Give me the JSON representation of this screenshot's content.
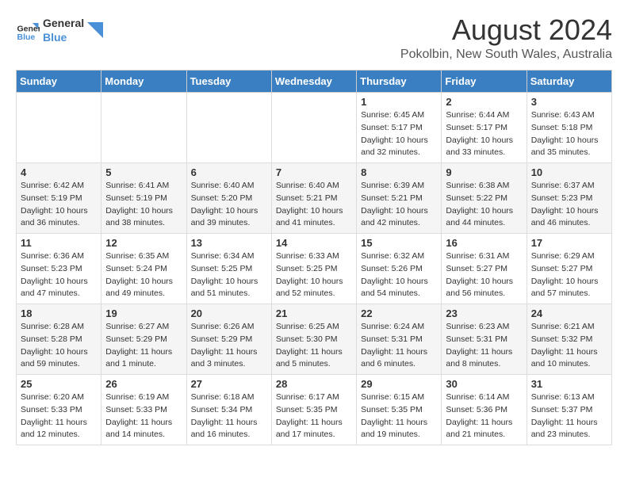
{
  "header": {
    "logo_line1": "General",
    "logo_line2": "Blue",
    "title": "August 2024",
    "subtitle": "Pokolbin, New South Wales, Australia"
  },
  "days_of_week": [
    "Sunday",
    "Monday",
    "Tuesday",
    "Wednesday",
    "Thursday",
    "Friday",
    "Saturday"
  ],
  "weeks": [
    [
      {
        "day": "",
        "info": ""
      },
      {
        "day": "",
        "info": ""
      },
      {
        "day": "",
        "info": ""
      },
      {
        "day": "",
        "info": ""
      },
      {
        "day": "1",
        "info": "Sunrise: 6:45 AM\nSunset: 5:17 PM\nDaylight: 10 hours\nand 32 minutes."
      },
      {
        "day": "2",
        "info": "Sunrise: 6:44 AM\nSunset: 5:17 PM\nDaylight: 10 hours\nand 33 minutes."
      },
      {
        "day": "3",
        "info": "Sunrise: 6:43 AM\nSunset: 5:18 PM\nDaylight: 10 hours\nand 35 minutes."
      }
    ],
    [
      {
        "day": "4",
        "info": "Sunrise: 6:42 AM\nSunset: 5:19 PM\nDaylight: 10 hours\nand 36 minutes."
      },
      {
        "day": "5",
        "info": "Sunrise: 6:41 AM\nSunset: 5:19 PM\nDaylight: 10 hours\nand 38 minutes."
      },
      {
        "day": "6",
        "info": "Sunrise: 6:40 AM\nSunset: 5:20 PM\nDaylight: 10 hours\nand 39 minutes."
      },
      {
        "day": "7",
        "info": "Sunrise: 6:40 AM\nSunset: 5:21 PM\nDaylight: 10 hours\nand 41 minutes."
      },
      {
        "day": "8",
        "info": "Sunrise: 6:39 AM\nSunset: 5:21 PM\nDaylight: 10 hours\nand 42 minutes."
      },
      {
        "day": "9",
        "info": "Sunrise: 6:38 AM\nSunset: 5:22 PM\nDaylight: 10 hours\nand 44 minutes."
      },
      {
        "day": "10",
        "info": "Sunrise: 6:37 AM\nSunset: 5:23 PM\nDaylight: 10 hours\nand 46 minutes."
      }
    ],
    [
      {
        "day": "11",
        "info": "Sunrise: 6:36 AM\nSunset: 5:23 PM\nDaylight: 10 hours\nand 47 minutes."
      },
      {
        "day": "12",
        "info": "Sunrise: 6:35 AM\nSunset: 5:24 PM\nDaylight: 10 hours\nand 49 minutes."
      },
      {
        "day": "13",
        "info": "Sunrise: 6:34 AM\nSunset: 5:25 PM\nDaylight: 10 hours\nand 51 minutes."
      },
      {
        "day": "14",
        "info": "Sunrise: 6:33 AM\nSunset: 5:25 PM\nDaylight: 10 hours\nand 52 minutes."
      },
      {
        "day": "15",
        "info": "Sunrise: 6:32 AM\nSunset: 5:26 PM\nDaylight: 10 hours\nand 54 minutes."
      },
      {
        "day": "16",
        "info": "Sunrise: 6:31 AM\nSunset: 5:27 PM\nDaylight: 10 hours\nand 56 minutes."
      },
      {
        "day": "17",
        "info": "Sunrise: 6:29 AM\nSunset: 5:27 PM\nDaylight: 10 hours\nand 57 minutes."
      }
    ],
    [
      {
        "day": "18",
        "info": "Sunrise: 6:28 AM\nSunset: 5:28 PM\nDaylight: 10 hours\nand 59 minutes."
      },
      {
        "day": "19",
        "info": "Sunrise: 6:27 AM\nSunset: 5:29 PM\nDaylight: 11 hours\nand 1 minute."
      },
      {
        "day": "20",
        "info": "Sunrise: 6:26 AM\nSunset: 5:29 PM\nDaylight: 11 hours\nand 3 minutes."
      },
      {
        "day": "21",
        "info": "Sunrise: 6:25 AM\nSunset: 5:30 PM\nDaylight: 11 hours\nand 5 minutes."
      },
      {
        "day": "22",
        "info": "Sunrise: 6:24 AM\nSunset: 5:31 PM\nDaylight: 11 hours\nand 6 minutes."
      },
      {
        "day": "23",
        "info": "Sunrise: 6:23 AM\nSunset: 5:31 PM\nDaylight: 11 hours\nand 8 minutes."
      },
      {
        "day": "24",
        "info": "Sunrise: 6:21 AM\nSunset: 5:32 PM\nDaylight: 11 hours\nand 10 minutes."
      }
    ],
    [
      {
        "day": "25",
        "info": "Sunrise: 6:20 AM\nSunset: 5:33 PM\nDaylight: 11 hours\nand 12 minutes."
      },
      {
        "day": "26",
        "info": "Sunrise: 6:19 AM\nSunset: 5:33 PM\nDaylight: 11 hours\nand 14 minutes."
      },
      {
        "day": "27",
        "info": "Sunrise: 6:18 AM\nSunset: 5:34 PM\nDaylight: 11 hours\nand 16 minutes."
      },
      {
        "day": "28",
        "info": "Sunrise: 6:17 AM\nSunset: 5:35 PM\nDaylight: 11 hours\nand 17 minutes."
      },
      {
        "day": "29",
        "info": "Sunrise: 6:15 AM\nSunset: 5:35 PM\nDaylight: 11 hours\nand 19 minutes."
      },
      {
        "day": "30",
        "info": "Sunrise: 6:14 AM\nSunset: 5:36 PM\nDaylight: 11 hours\nand 21 minutes."
      },
      {
        "day": "31",
        "info": "Sunrise: 6:13 AM\nSunset: 5:37 PM\nDaylight: 11 hours\nand 23 minutes."
      }
    ]
  ]
}
